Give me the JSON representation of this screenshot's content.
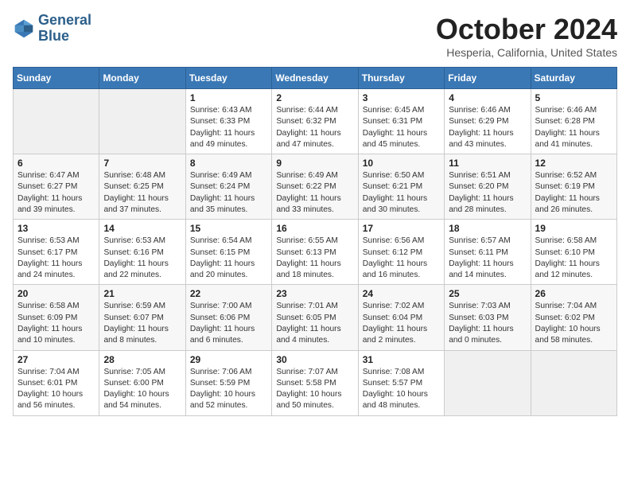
{
  "header": {
    "logo_line1": "General",
    "logo_line2": "Blue",
    "month_title": "October 2024",
    "location": "Hesperia, California, United States"
  },
  "days_of_week": [
    "Sunday",
    "Monday",
    "Tuesday",
    "Wednesday",
    "Thursday",
    "Friday",
    "Saturday"
  ],
  "weeks": [
    [
      {
        "day": "",
        "info": ""
      },
      {
        "day": "",
        "info": ""
      },
      {
        "day": "1",
        "info": "Sunrise: 6:43 AM\nSunset: 6:33 PM\nDaylight: 11 hours and 49 minutes."
      },
      {
        "day": "2",
        "info": "Sunrise: 6:44 AM\nSunset: 6:32 PM\nDaylight: 11 hours and 47 minutes."
      },
      {
        "day": "3",
        "info": "Sunrise: 6:45 AM\nSunset: 6:31 PM\nDaylight: 11 hours and 45 minutes."
      },
      {
        "day": "4",
        "info": "Sunrise: 6:46 AM\nSunset: 6:29 PM\nDaylight: 11 hours and 43 minutes."
      },
      {
        "day": "5",
        "info": "Sunrise: 6:46 AM\nSunset: 6:28 PM\nDaylight: 11 hours and 41 minutes."
      }
    ],
    [
      {
        "day": "6",
        "info": "Sunrise: 6:47 AM\nSunset: 6:27 PM\nDaylight: 11 hours and 39 minutes."
      },
      {
        "day": "7",
        "info": "Sunrise: 6:48 AM\nSunset: 6:25 PM\nDaylight: 11 hours and 37 minutes."
      },
      {
        "day": "8",
        "info": "Sunrise: 6:49 AM\nSunset: 6:24 PM\nDaylight: 11 hours and 35 minutes."
      },
      {
        "day": "9",
        "info": "Sunrise: 6:49 AM\nSunset: 6:22 PM\nDaylight: 11 hours and 33 minutes."
      },
      {
        "day": "10",
        "info": "Sunrise: 6:50 AM\nSunset: 6:21 PM\nDaylight: 11 hours and 30 minutes."
      },
      {
        "day": "11",
        "info": "Sunrise: 6:51 AM\nSunset: 6:20 PM\nDaylight: 11 hours and 28 minutes."
      },
      {
        "day": "12",
        "info": "Sunrise: 6:52 AM\nSunset: 6:19 PM\nDaylight: 11 hours and 26 minutes."
      }
    ],
    [
      {
        "day": "13",
        "info": "Sunrise: 6:53 AM\nSunset: 6:17 PM\nDaylight: 11 hours and 24 minutes."
      },
      {
        "day": "14",
        "info": "Sunrise: 6:53 AM\nSunset: 6:16 PM\nDaylight: 11 hours and 22 minutes."
      },
      {
        "day": "15",
        "info": "Sunrise: 6:54 AM\nSunset: 6:15 PM\nDaylight: 11 hours and 20 minutes."
      },
      {
        "day": "16",
        "info": "Sunrise: 6:55 AM\nSunset: 6:13 PM\nDaylight: 11 hours and 18 minutes."
      },
      {
        "day": "17",
        "info": "Sunrise: 6:56 AM\nSunset: 6:12 PM\nDaylight: 11 hours and 16 minutes."
      },
      {
        "day": "18",
        "info": "Sunrise: 6:57 AM\nSunset: 6:11 PM\nDaylight: 11 hours and 14 minutes."
      },
      {
        "day": "19",
        "info": "Sunrise: 6:58 AM\nSunset: 6:10 PM\nDaylight: 11 hours and 12 minutes."
      }
    ],
    [
      {
        "day": "20",
        "info": "Sunrise: 6:58 AM\nSunset: 6:09 PM\nDaylight: 11 hours and 10 minutes."
      },
      {
        "day": "21",
        "info": "Sunrise: 6:59 AM\nSunset: 6:07 PM\nDaylight: 11 hours and 8 minutes."
      },
      {
        "day": "22",
        "info": "Sunrise: 7:00 AM\nSunset: 6:06 PM\nDaylight: 11 hours and 6 minutes."
      },
      {
        "day": "23",
        "info": "Sunrise: 7:01 AM\nSunset: 6:05 PM\nDaylight: 11 hours and 4 minutes."
      },
      {
        "day": "24",
        "info": "Sunrise: 7:02 AM\nSunset: 6:04 PM\nDaylight: 11 hours and 2 minutes."
      },
      {
        "day": "25",
        "info": "Sunrise: 7:03 AM\nSunset: 6:03 PM\nDaylight: 11 hours and 0 minutes."
      },
      {
        "day": "26",
        "info": "Sunrise: 7:04 AM\nSunset: 6:02 PM\nDaylight: 10 hours and 58 minutes."
      }
    ],
    [
      {
        "day": "27",
        "info": "Sunrise: 7:04 AM\nSunset: 6:01 PM\nDaylight: 10 hours and 56 minutes."
      },
      {
        "day": "28",
        "info": "Sunrise: 7:05 AM\nSunset: 6:00 PM\nDaylight: 10 hours and 54 minutes."
      },
      {
        "day": "29",
        "info": "Sunrise: 7:06 AM\nSunset: 5:59 PM\nDaylight: 10 hours and 52 minutes."
      },
      {
        "day": "30",
        "info": "Sunrise: 7:07 AM\nSunset: 5:58 PM\nDaylight: 10 hours and 50 minutes."
      },
      {
        "day": "31",
        "info": "Sunrise: 7:08 AM\nSunset: 5:57 PM\nDaylight: 10 hours and 48 minutes."
      },
      {
        "day": "",
        "info": ""
      },
      {
        "day": "",
        "info": ""
      }
    ]
  ]
}
